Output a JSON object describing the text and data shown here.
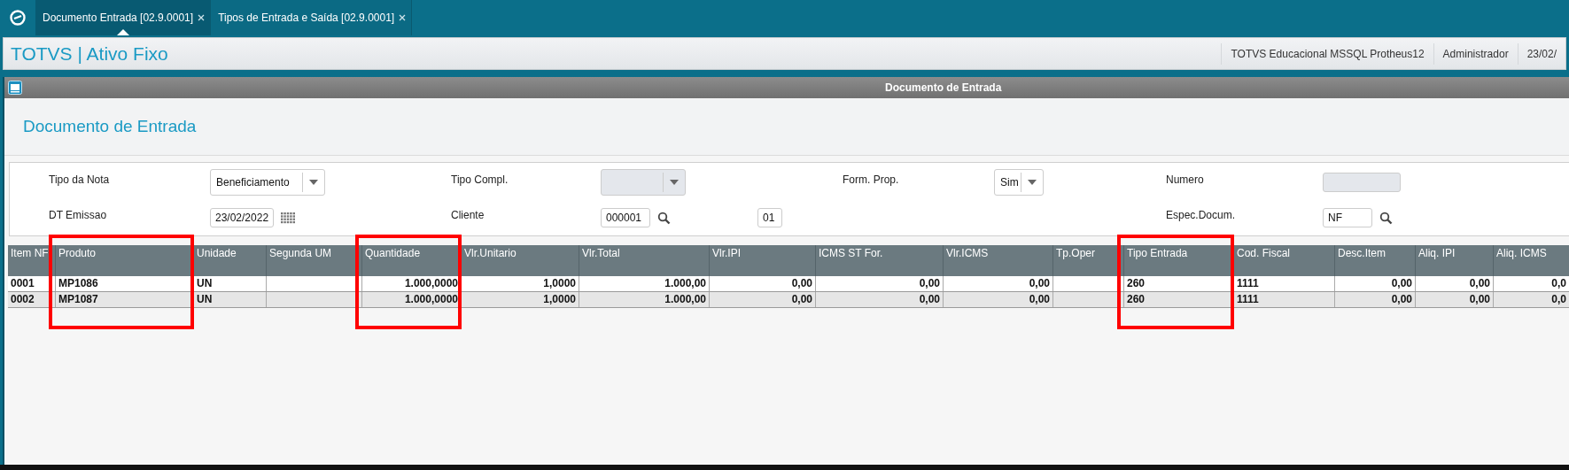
{
  "tabs": [
    {
      "label": "Documento Entrada [02.9.0001]",
      "selected": true
    },
    {
      "label": "Tipos de Entrada e Saída [02.9.0001]",
      "selected": false
    }
  ],
  "header": {
    "title": "TOTVS | Ativo Fixo",
    "info": [
      "TOTVS Educacional MSSQL Protheus12",
      "Administrador",
      "23/02/"
    ]
  },
  "window": {
    "title": "Documento de Entrada"
  },
  "page_title": "Documento de Entrada",
  "form": {
    "rows": [
      [
        {
          "label": "Tipo da Nota",
          "kind": "select",
          "value": "Beneficiamento",
          "disabled": false
        },
        {
          "label": "Tipo Compl.",
          "kind": "select",
          "disabled": true
        },
        {
          "label": "Form. Prop.",
          "kind": "select",
          "value": "Sim",
          "disabled": false
        },
        {
          "label": "Numero",
          "kind": "text",
          "disabled": true
        }
      ],
      [
        {
          "label": "DT Emissao",
          "kind": "date",
          "value": "23/02/2022",
          "disabled": false
        },
        {
          "label": "Cliente",
          "kind": "lookup",
          "value": "000001",
          "extra": "01",
          "disabled": false
        },
        {
          "kind": "blank"
        },
        {
          "label": "Espec.Docum.",
          "kind": "lookup",
          "value": "NF",
          "disabled": false
        }
      ]
    ]
  },
  "table": {
    "columns": [
      {
        "label": "Item NF",
        "kind": "text",
        "highlighted": false
      },
      {
        "label": "Produto",
        "kind": "text",
        "highlighted": true
      },
      {
        "label": "Unidade",
        "kind": "text",
        "highlighted": false
      },
      {
        "label": "Segunda UM",
        "kind": "text",
        "highlighted": false
      },
      {
        "label": "Quantidade",
        "kind": "number",
        "highlighted": true
      },
      {
        "label": "Vlr.Unitario",
        "kind": "number",
        "highlighted": false
      },
      {
        "label": "Vlr.Total",
        "kind": "number",
        "highlighted": false
      },
      {
        "label": "Vlr.IPI",
        "kind": "number",
        "highlighted": false
      },
      {
        "label": "ICMS ST For.",
        "kind": "number",
        "highlighted": false
      },
      {
        "label": "Vlr.ICMS",
        "kind": "number",
        "highlighted": false
      },
      {
        "label": "Tp.Oper",
        "kind": "text",
        "highlighted": false
      },
      {
        "label": "Tipo Entrada",
        "kind": "text",
        "highlighted": true
      },
      {
        "label": "Cod. Fiscal",
        "kind": "text",
        "highlighted": false
      },
      {
        "label": "Desc.Item",
        "kind": "number",
        "highlighted": false
      },
      {
        "label": "Aliq. IPI",
        "kind": "number",
        "highlighted": false
      },
      {
        "label": "Aliq. ICMS",
        "kind": "number",
        "highlighted": false
      }
    ],
    "rows": [
      [
        "0001",
        "MP1086",
        "UN",
        "",
        "1.000,0000",
        "1,0000",
        "1.000,00",
        "0,00",
        "0,00",
        "0,00",
        "",
        "260",
        "1111",
        "0,00",
        "0,00",
        "0,0"
      ],
      [
        "0002",
        "MP1087",
        "UN",
        "",
        "1.000,0000",
        "1,0000",
        "1.000,00",
        "0,00",
        "0,00",
        "0,00",
        "",
        "260",
        "1111",
        "0,00",
        "0,00",
        "0,0"
      ]
    ]
  }
}
